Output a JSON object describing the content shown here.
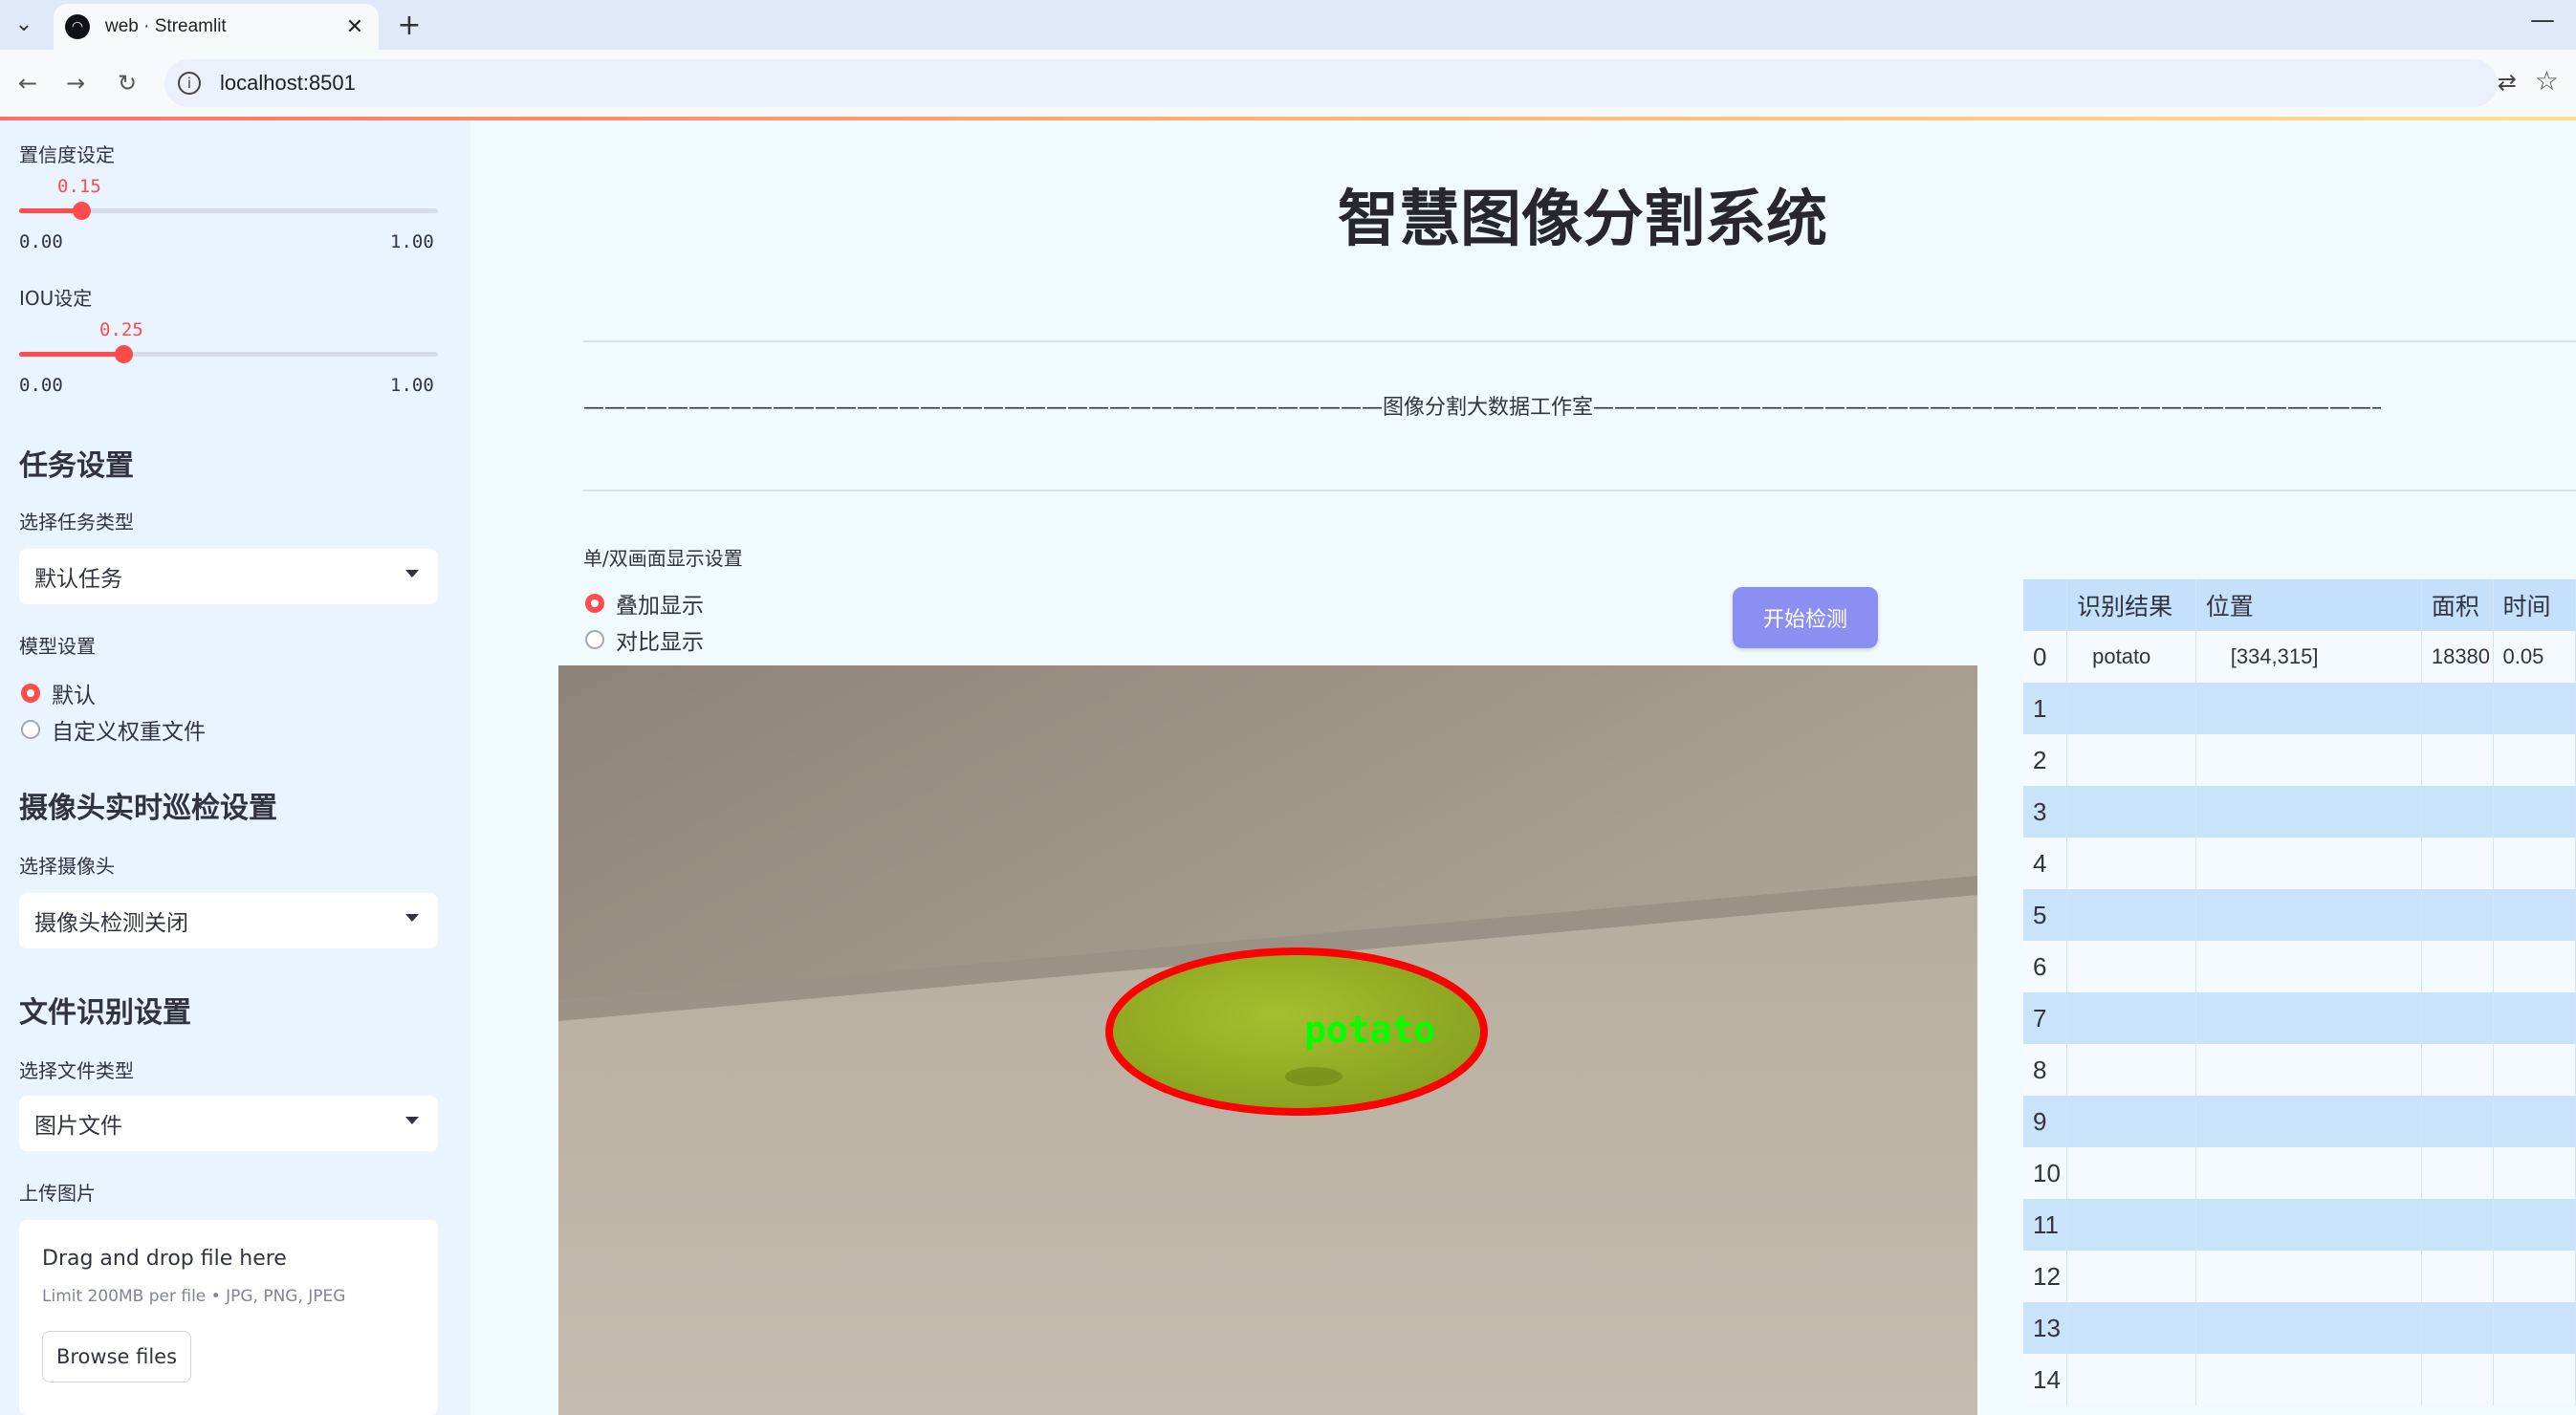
{
  "browser": {
    "tab_title": "web · Streamlit",
    "url": "localhost:8501"
  },
  "sidebar": {
    "confidence": {
      "label": "置信度设定",
      "value": "0.15",
      "value_fraction": 0.15,
      "min": "0.00",
      "max": "1.00"
    },
    "iou": {
      "label": "IOU设定",
      "value": "0.25",
      "value_fraction": 0.25,
      "min": "0.00",
      "max": "1.00"
    },
    "task": {
      "heading": "任务设置",
      "label": "选择任务类型",
      "selected": "默认任务"
    },
    "model": {
      "label": "模型设置",
      "options": [
        "默认",
        "自定义权重文件"
      ],
      "selected_index": 0
    },
    "camera": {
      "heading": "摄像头实时巡检设置",
      "label": "选择摄像头",
      "selected": "摄像头检测关闭"
    },
    "file": {
      "heading": "文件识别设置",
      "label": "选择文件类型",
      "selected": "图片文件"
    },
    "upload": {
      "label": "上传图片",
      "drop_text": "Drag and drop file here",
      "limit_text": "Limit 200MB per file • JPG, PNG, JPEG",
      "browse_label": "Browse files"
    }
  },
  "main": {
    "title": "智慧图像分割系统",
    "studio_text": "——————————————————————————————————————图像分割大数据工作室——————————————————————————————————————",
    "display_label": "单/双画面显示设置",
    "display_options": [
      "叠加显示",
      "对比显示"
    ],
    "display_selected_index": 0,
    "start_button": "开始检测",
    "detection_label": "potato",
    "colors": {
      "accent": "#ff4b4b",
      "button": "#8c8ff2",
      "mask": "#9acd32",
      "outline": "#ff0000",
      "label_text": "#00ff00"
    }
  },
  "table": {
    "columns": [
      "",
      "识别结果",
      "位置",
      "面积",
      "时间"
    ],
    "rows": [
      [
        "0",
        "potato",
        "[334,315]",
        "18380",
        "0.05"
      ],
      [
        "1",
        "",
        "",
        "",
        ""
      ],
      [
        "2",
        "",
        "",
        "",
        ""
      ],
      [
        "3",
        "",
        "",
        "",
        ""
      ],
      [
        "4",
        "",
        "",
        "",
        ""
      ],
      [
        "5",
        "",
        "",
        "",
        ""
      ],
      [
        "6",
        "",
        "",
        "",
        ""
      ],
      [
        "7",
        "",
        "",
        "",
        ""
      ],
      [
        "8",
        "",
        "",
        "",
        ""
      ],
      [
        "9",
        "",
        "",
        "",
        ""
      ],
      [
        "10",
        "",
        "",
        "",
        ""
      ],
      [
        "11",
        "",
        "",
        "",
        ""
      ],
      [
        "12",
        "",
        "",
        "",
        ""
      ],
      [
        "13",
        "",
        "",
        "",
        ""
      ],
      [
        "14",
        "",
        "",
        "",
        ""
      ]
    ]
  }
}
